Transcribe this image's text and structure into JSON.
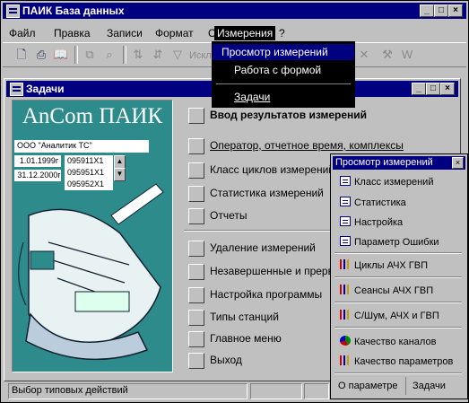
{
  "app": {
    "title": "ПАИК База данных"
  },
  "menubar": [
    "Файл",
    "Правка",
    "Записи",
    "Формат",
    "Окно",
    "Измерения",
    "?"
  ],
  "toolbar": {
    "disabled_text": "Исключ"
  },
  "dropdown": {
    "items": [
      "Просмотр измерений",
      "Работа с формой",
      "Задачи"
    ]
  },
  "task_window": {
    "title": "Задачи",
    "logo": "AnCom ПАИК",
    "org": "ООО \"Аналитик ТС\"",
    "date_from": "1.01.1999г",
    "date_to": "31.12.2000г",
    "codes": [
      "095911X1",
      "095951X1",
      "095952X1"
    ],
    "heading": "Ввод результатов измерений",
    "actions": [
      "Оператор, отчетное время, комплексы",
      "Класс циклов измерений",
      "Статистика измерений",
      "Отчеты",
      "Удаление измерений",
      "Незавершенные и прерва",
      "Настройка программы",
      "Типы станций",
      "Главное меню",
      "Выход"
    ]
  },
  "palette": {
    "title": "Просмотр измерений",
    "items": [
      {
        "label": "Класс измерений",
        "icon": "form-icon"
      },
      {
        "label": "Статистика",
        "icon": "form-icon"
      },
      {
        "label": "Настройка",
        "icon": "form-icon"
      },
      {
        "label": "Параметр  Ошибки",
        "icon": "form-icon"
      },
      {
        "label": "Циклы  АЧХ  ГВП",
        "icon": "chart-icon"
      },
      {
        "label": "Сеансы  АЧХ  ГВП",
        "icon": "chart-icon"
      },
      {
        "label": "С/Шум, АЧХ и ГВП",
        "icon": "chart-icon"
      },
      {
        "label": "Качество каналов",
        "icon": "pie-chart-icon"
      },
      {
        "label": "Качество параметров",
        "icon": "chart-icon"
      }
    ],
    "about": "О параметре",
    "tasks": "Задачи"
  },
  "status": {
    "text": "Выбор типовых действий"
  }
}
